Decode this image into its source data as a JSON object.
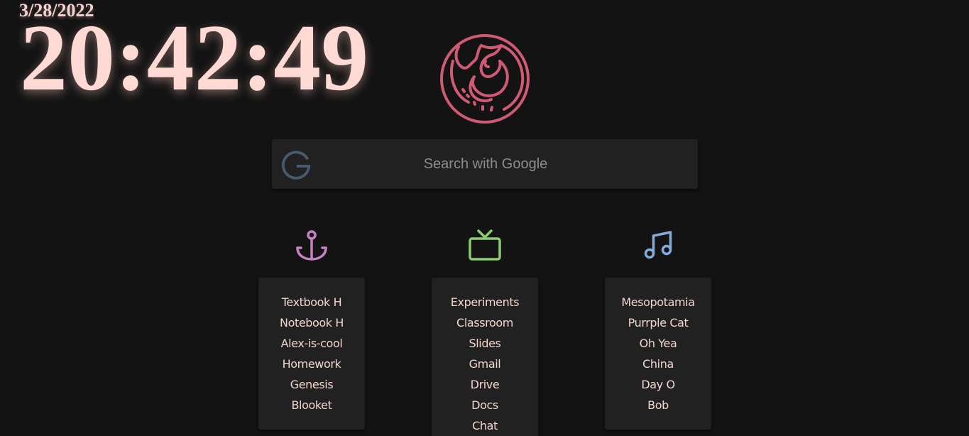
{
  "date": "3/28/2022",
  "time": "20:42:49",
  "search": {
    "placeholder": "Search with Google",
    "engine_icon": "google-g-icon"
  },
  "logo_icon": "firefox-icon",
  "colors": {
    "background": "#131313",
    "card": "#212121",
    "text": "#f4d6d0",
    "logo": "#d05a73",
    "anchor_icon": "#c882bf",
    "tv_icon": "#8dcc6e",
    "music_icon": "#82acdc"
  },
  "columns": [
    {
      "icon": "anchor-icon",
      "links": [
        "Textbook H",
        "Notebook H",
        "Alex-is-cool",
        "Homework",
        "Genesis",
        "Blooket"
      ]
    },
    {
      "icon": "tv-icon",
      "links": [
        "Experiments",
        "Classroom",
        "Slides",
        "Gmail",
        "Drive",
        "Docs",
        "Chat"
      ]
    },
    {
      "icon": "music-note-icon",
      "links": [
        "Mesopotamia",
        "Purrple Cat",
        "Oh Yea",
        "China",
        "Day O",
        "Bob"
      ]
    }
  ]
}
